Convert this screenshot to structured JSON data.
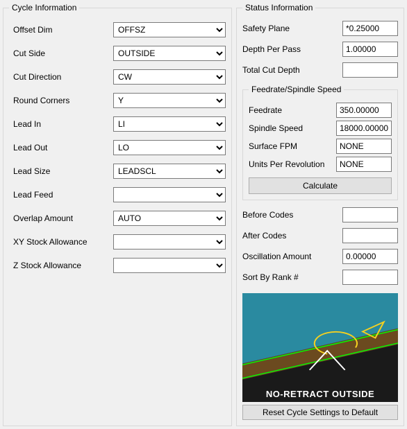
{
  "cycle": {
    "legend": "Cycle Information",
    "fields": {
      "offset_dim": {
        "label": "Offset Dim",
        "value": "OFFSZ"
      },
      "cut_side": {
        "label": "Cut Side",
        "value": "OUTSIDE"
      },
      "cut_direction": {
        "label": "Cut Direction",
        "value": "CW"
      },
      "round_corners": {
        "label": "Round Corners",
        "value": "Y"
      },
      "lead_in": {
        "label": "Lead In",
        "value": "LI"
      },
      "lead_out": {
        "label": "Lead Out",
        "value": "LO"
      },
      "lead_size": {
        "label": "Lead Size",
        "value": "LEADSCL"
      },
      "lead_feed": {
        "label": "Lead Feed",
        "value": ""
      },
      "overlap_amount": {
        "label": "Overlap Amount",
        "value": "AUTO"
      },
      "xy_stock": {
        "label": "XY Stock Allowance",
        "value": ""
      },
      "z_stock": {
        "label": "Z Stock Allowance",
        "value": ""
      }
    }
  },
  "status": {
    "legend": "Status Information",
    "safety_plane": {
      "label": "Safety Plane",
      "value": "*0.25000"
    },
    "depth_per_pass": {
      "label": "Depth Per Pass",
      "value": "1.00000"
    },
    "total_cut_depth": {
      "label": "Total Cut Depth",
      "value": ""
    },
    "feed_speed": {
      "legend": "Feedrate/Spindle Speed",
      "feedrate": {
        "label": "Feedrate",
        "value": "350.00000"
      },
      "spindle_speed": {
        "label": "Spindle Speed",
        "value": "18000.00000"
      },
      "surface_fpm": {
        "label": "Surface FPM",
        "value": "NONE"
      },
      "units_per_rev": {
        "label": "Units Per Revolution",
        "value": "NONE"
      },
      "calc_button": "Calculate"
    },
    "before_codes": {
      "label": "Before Codes",
      "value": ""
    },
    "after_codes": {
      "label": "After Codes",
      "value": ""
    },
    "oscillation": {
      "label": "Oscillation Amount",
      "value": "0.00000"
    },
    "sort_rank": {
      "label": "Sort By Rank #",
      "value": ""
    },
    "preview_caption": "NO-RETRACT OUTSIDE",
    "reset_button": "Reset Cycle Settings to Default"
  }
}
